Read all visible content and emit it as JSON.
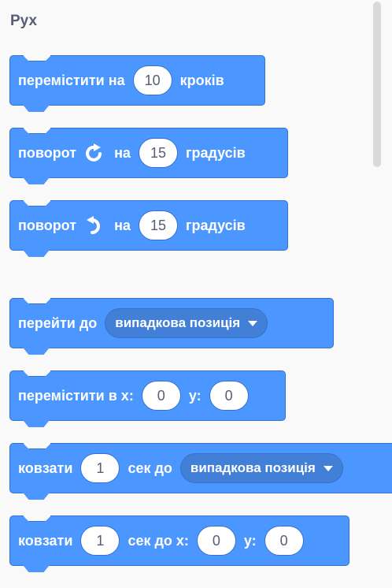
{
  "category": {
    "title": "Рух"
  },
  "blocks": {
    "move_steps": {
      "prefix": "перемістити на",
      "value": "10",
      "suffix": "кроків"
    },
    "turn_right": {
      "prefix": "поворот",
      "icon": "rotate-right-icon",
      "middle": "на",
      "value": "15",
      "suffix": "градусів"
    },
    "turn_left": {
      "prefix": "поворот",
      "icon": "rotate-left-icon",
      "middle": "на",
      "value": "15",
      "suffix": "градусів"
    },
    "goto": {
      "prefix": "перейти до",
      "dropdown": "випадкова позиція"
    },
    "goto_xy": {
      "prefix": "перемістити в х:",
      "x": "0",
      "ylabel": "у:",
      "y": "0"
    },
    "glide_to": {
      "prefix": "ковзати",
      "value": "1",
      "middle": "сек до",
      "dropdown": "випадкова позиція"
    },
    "glide_xy": {
      "prefix": "ковзати",
      "value": "1",
      "middle": "сек до х:",
      "x": "0",
      "ylabel": "у:",
      "y": "0"
    }
  },
  "colors": {
    "block": "#4c97ff",
    "block_border": "#3373cc",
    "dropdown": "#4280d7",
    "title": "#575e75"
  }
}
